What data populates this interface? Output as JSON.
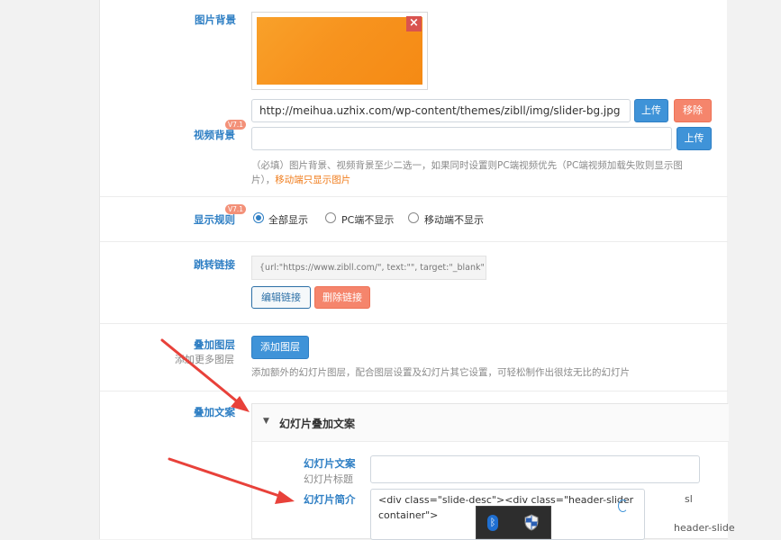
{
  "image_bg": {
    "label": "图片背景",
    "delete_icon": "close-icon",
    "preview_color": "#f7931e"
  },
  "version_badge": "V7.1",
  "video_bg": {
    "label": "视频背景",
    "image_url": "http://meihua.uzhix.com/wp-content/themes/zibll/img/slider-bg.jpg",
    "upload_label": "上传",
    "remove_label": "移除",
    "video_url": "",
    "upload2_label": "上传",
    "help_main": "（必填）图片背景、视频背景至少二选一，如果同时设置则PC端视频优先（PC端视频加载失败则显示图",
    "help_line2_prefix": "片），",
    "help_highlight": "移动端只显示图片"
  },
  "display_rule": {
    "label": "显示规则",
    "options": [
      "全部显示",
      "PC端不显示",
      "移动端不显示"
    ],
    "selected_index": 0
  },
  "link": {
    "label": "跳转链接",
    "value": "{url:\"https://www.zibll.com/\", text:\"\", target:\"_blank\"}",
    "edit_label": "编辑链接",
    "delete_label": "删除链接"
  },
  "layers": {
    "label": "叠加图层",
    "sublabel": "添加更多图层",
    "add_label": "添加图层",
    "help": "添加额外的幻灯片图层，配合图层设置及幻灯片其它设置，可轻松制作出很炫无比的幻灯片"
  },
  "overlay_text": {
    "label": "叠加文案",
    "section_title": "幻灯片叠加文案",
    "chevron_icon": "chevron-down-icon",
    "fields": {
      "title_label": "幻灯片文案",
      "title_sub": "幻灯片标题",
      "title_value": "",
      "desc_label": "幻灯片简介",
      "desc_value_line1": "<div class=\"slide-desc\"><div class=\"header-slider",
      "desc_value_line2": "container\">"
    }
  },
  "taskbar": {
    "icons": [
      "bluetooth-icon",
      "shield-icon"
    ]
  },
  "right_fragments": [
    "sl",
    "header-slide"
  ],
  "colors": {
    "label_blue": "#2f7fc4",
    "button_blue": "#3f93d8",
    "button_red": "#f5856c",
    "highlight_orange": "#f07c1b",
    "arrow_red": "#e8413a"
  }
}
